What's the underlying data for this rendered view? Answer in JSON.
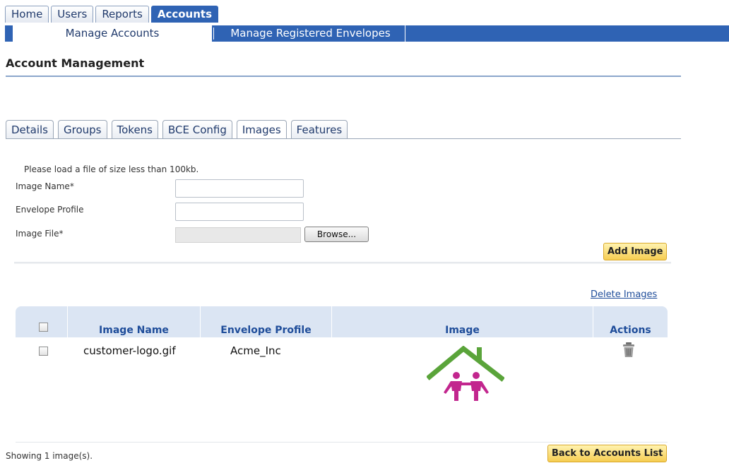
{
  "top_nav": {
    "tabs": [
      {
        "label": "Home"
      },
      {
        "label": "Users"
      },
      {
        "label": "Reports"
      },
      {
        "label": "Accounts",
        "active": true
      }
    ],
    "sub_tabs": [
      {
        "label": "Manage Accounts",
        "active": true
      },
      {
        "label": "Manage Registered Envelopes"
      }
    ]
  },
  "page": {
    "title": "Account Management"
  },
  "section_tabs": [
    {
      "label": "Details"
    },
    {
      "label": "Groups"
    },
    {
      "label": "Tokens"
    },
    {
      "label": "BCE Config"
    },
    {
      "label": "Images",
      "active": true
    },
    {
      "label": "Features"
    }
  ],
  "form": {
    "note": "Please load a file of size less than 100kb.",
    "image_name_label": "Image Name",
    "envelope_profile_label": "Envelope Profile",
    "image_file_label": "Image File",
    "required_mark": "*",
    "image_name_value": "",
    "envelope_profile_value": "",
    "browse_label": "Browse...",
    "add_button": "Add Image"
  },
  "delete_link": "Delete Images",
  "table": {
    "headers": {
      "image_name": "Image Name",
      "envelope_profile": "Envelope Profile",
      "image": "Image",
      "actions": "Actions"
    },
    "rows": [
      {
        "image_name": "customer-logo.gif",
        "envelope_profile": "Acme_Inc",
        "image_icon": "house-family-logo",
        "action_icon": "trash-icon"
      }
    ]
  },
  "footer": {
    "count_text": "Showing 1 image(s).",
    "back_button": "Back to Accounts List"
  },
  "colors": {
    "nav_blue": "#2f63b4",
    "header_bg": "#dbe5f3",
    "button_yellow": "#f6cd52",
    "logo_green": "#5aa43a",
    "logo_magenta": "#c2268e"
  }
}
